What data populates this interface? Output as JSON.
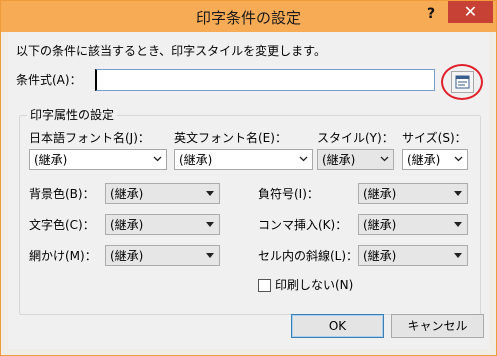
{
  "window": {
    "title": "印字条件の設定",
    "help_label": "?",
    "close_label": "✕"
  },
  "description": "以下の条件に該当するとき、印字スタイルを変更します。",
  "condition": {
    "label": "条件式(A)：",
    "value": ""
  },
  "group": {
    "label": "印字属性の設定",
    "japanese_font": {
      "label": "日本語フォント名(J)：",
      "value": "(継承)"
    },
    "english_font": {
      "label": "英文フォント名(E)：",
      "value": "(継承)"
    },
    "style": {
      "label": "スタイル(Y)：",
      "value": "(継承)"
    },
    "size": {
      "label": "サイズ(S)：",
      "value": "(継承)"
    },
    "background_color": {
      "label": "背景色(B)：",
      "value": "(継承)"
    },
    "text_color": {
      "label": "文字色(C)：",
      "value": "(継承)"
    },
    "hatching": {
      "label": "網かけ(M)：",
      "value": "(継承)"
    },
    "minus_sign": {
      "label": "負符号(I)：",
      "value": "(継承)"
    },
    "comma_insert": {
      "label": "コンマ挿入(K)：",
      "value": "(継承)"
    },
    "cell_diagonal": {
      "label": "セル内の斜線(L)：",
      "value": "(継承)"
    },
    "no_print": {
      "label": "印刷しない(N)",
      "checked": false
    }
  },
  "buttons": {
    "ok": "OK",
    "cancel": "キャンセル"
  },
  "colors": {
    "titlebar": "#f7ab55",
    "close": "#c74134",
    "highlight": "#e0202a"
  }
}
